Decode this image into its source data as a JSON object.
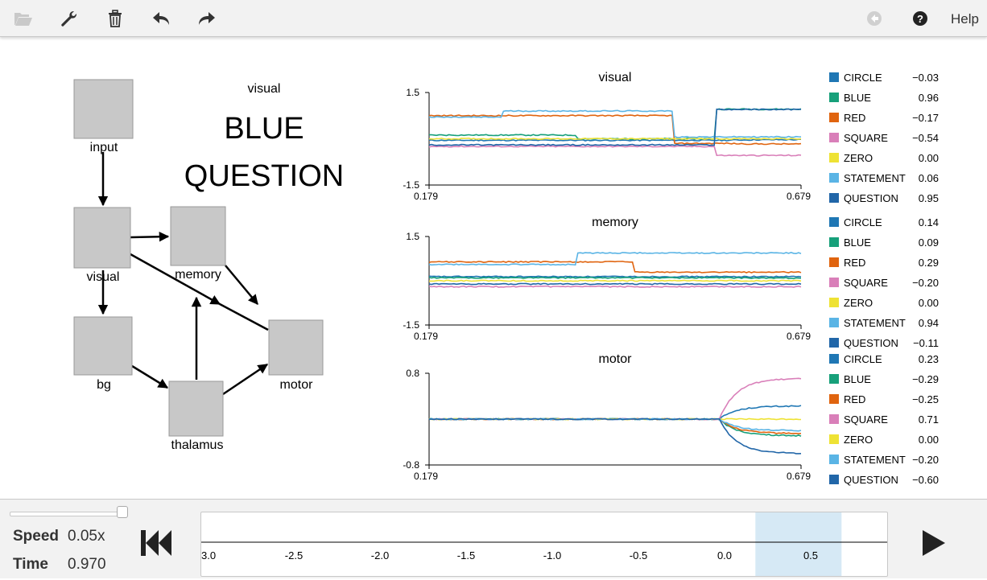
{
  "toolbar": {
    "icons": [
      "folder-open-icon",
      "wrench-icon",
      "trash-icon",
      "undo-icon",
      "redo-icon",
      "reset-circle-icon",
      "question-circle-icon"
    ],
    "help_label": "Help"
  },
  "network": {
    "nodes": {
      "input": "input",
      "visual": "visual",
      "memory": "memory",
      "bg": "bg",
      "thalamus": "thalamus",
      "motor": "motor"
    },
    "display": {
      "label": "visual",
      "line1": "BLUE",
      "line2": "QUESTION"
    }
  },
  "chart_data": [
    {
      "type": "line",
      "title": "visual",
      "x": [
        0.179,
        0.679
      ],
      "xticks": [
        "0.179",
        "0.679"
      ],
      "ylim": [
        -1.5,
        1.5
      ],
      "yticks": [
        "1.5",
        "-1.5"
      ],
      "series": [
        {
          "name": "CIRCLE",
          "color": "#1f77b4",
          "value": "−0.03"
        },
        {
          "name": "BLUE",
          "color": "#17a07a",
          "value": "0.96"
        },
        {
          "name": "RED",
          "color": "#e0640f",
          "value": "−0.17"
        },
        {
          "name": "SQUARE",
          "color": "#d97fb9",
          "value": "−0.54"
        },
        {
          "name": "ZERO",
          "color": "#eee234",
          "value": "0.00"
        },
        {
          "name": "STATEMENT",
          "color": "#5ab4e5",
          "value": "0.06"
        },
        {
          "name": "QUESTION",
          "color": "#2166a8",
          "value": "0.95"
        }
      ]
    },
    {
      "type": "line",
      "title": "memory",
      "x": [
        0.179,
        0.679
      ],
      "xticks": [
        "0.179",
        "0.679"
      ],
      "ylim": [
        -1.5,
        1.5
      ],
      "yticks": [
        "1.5",
        "-1.5"
      ],
      "series": [
        {
          "name": "CIRCLE",
          "color": "#1f77b4",
          "value": "0.14"
        },
        {
          "name": "BLUE",
          "color": "#17a07a",
          "value": "0.09"
        },
        {
          "name": "RED",
          "color": "#e0640f",
          "value": "0.29"
        },
        {
          "name": "SQUARE",
          "color": "#d97fb9",
          "value": "−0.20"
        },
        {
          "name": "ZERO",
          "color": "#eee234",
          "value": "0.00"
        },
        {
          "name": "STATEMENT",
          "color": "#5ab4e5",
          "value": "0.94"
        },
        {
          "name": "QUESTION",
          "color": "#2166a8",
          "value": "−0.11"
        }
      ]
    },
    {
      "type": "line",
      "title": "motor",
      "x": [
        0.179,
        0.679
      ],
      "xticks": [
        "0.179",
        "0.679"
      ],
      "ylim": [
        -0.8,
        0.8
      ],
      "yticks": [
        "0.8",
        "-0.8"
      ],
      "series": [
        {
          "name": "CIRCLE",
          "color": "#1f77b4",
          "value": "0.23"
        },
        {
          "name": "BLUE",
          "color": "#17a07a",
          "value": "−0.29"
        },
        {
          "name": "RED",
          "color": "#e0640f",
          "value": "−0.25"
        },
        {
          "name": "SQUARE",
          "color": "#d97fb9",
          "value": "0.71"
        },
        {
          "name": "ZERO",
          "color": "#eee234",
          "value": "0.00"
        },
        {
          "name": "STATEMENT",
          "color": "#5ab4e5",
          "value": "−0.20"
        },
        {
          "name": "QUESTION",
          "color": "#2166a8",
          "value": "−0.60"
        }
      ]
    }
  ],
  "footer": {
    "speed_label": "Speed",
    "speed_value": "0.05x",
    "time_label": "Time",
    "time_value": "0.970",
    "timeline_ticks": [
      "3.0",
      "-2.5",
      "-2.0",
      "-1.5",
      "-1.0",
      "-0.5",
      "0.0",
      "0.5"
    ],
    "timeline_window": [
      0.179,
      0.679
    ],
    "rewind_icon": "skip-back-icon",
    "play_icon": "play-icon"
  }
}
